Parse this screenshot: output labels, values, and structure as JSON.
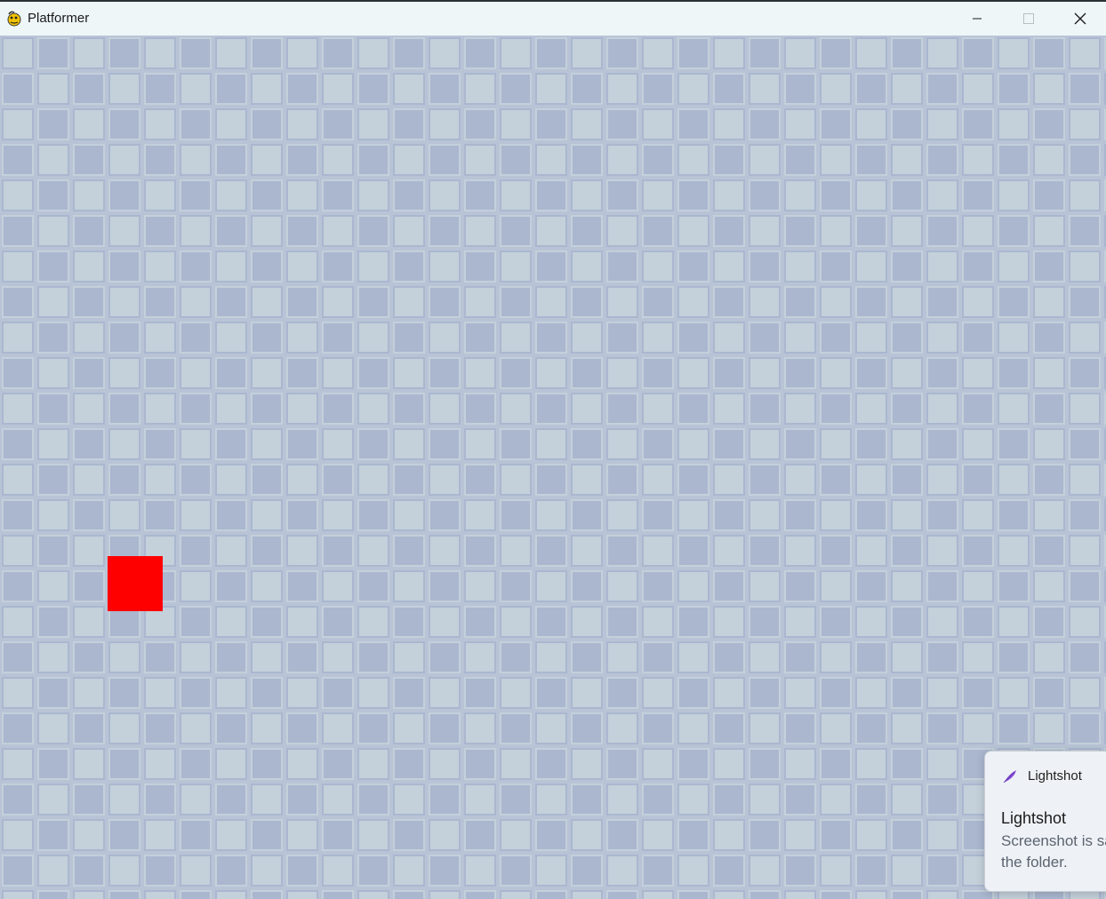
{
  "window": {
    "title": "Platformer",
    "app_icon": "python-snake-icon",
    "controls": {
      "minimize_icon": "minimize-icon",
      "maximize_icon": "maximize-icon",
      "close_icon": "close-icon"
    }
  },
  "game": {
    "background_color": "#aab7cf",
    "tile_light_color": "#c4d0da",
    "tile_dark_color": "#aab7cf",
    "player_color": "#ff0000"
  },
  "notification": {
    "app_name": "Lightshot",
    "app_icon": "feather-icon",
    "title": "Lightshot",
    "body": "Screenshot is saved to the folder."
  }
}
